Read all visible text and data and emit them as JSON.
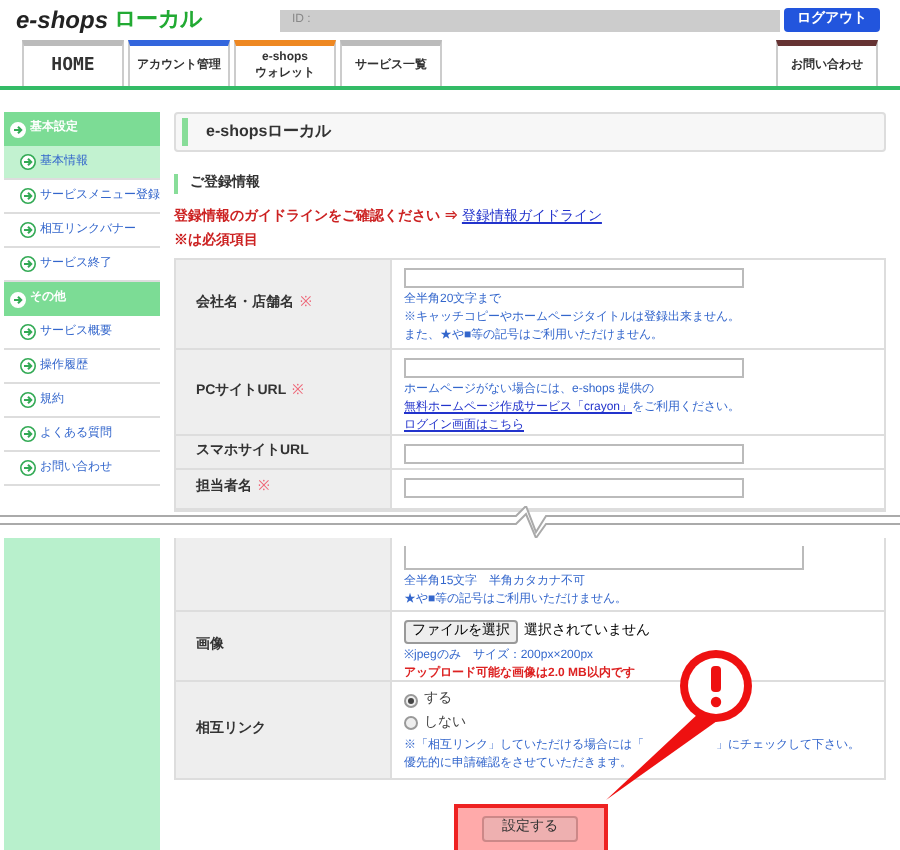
{
  "logo": {
    "part_a": "e-shops",
    "part_b": "ローカル"
  },
  "header": {
    "id_label": "ID :",
    "logout_button": "ログアウト"
  },
  "tabs": [
    {
      "label": "HOME",
      "color": "#bbbbbb"
    },
    {
      "label": "アカウント管理",
      "color": "#3366dd"
    },
    {
      "label": "e-shops\nウォレット",
      "color": "#ee8822"
    },
    {
      "label": "サービス一覧",
      "color": "#bbbbbb"
    }
  ],
  "contact_tab": {
    "label": "お問い合わせ",
    "color": "#663333"
  },
  "sidebar": [
    {
      "title": "基本設定",
      "items": [
        {
          "label": "基本情報",
          "selected": true
        },
        {
          "label": "サービスメニュー登録",
          "selected": false
        },
        {
          "label": "相互リンクバナー",
          "selected": false
        },
        {
          "label": "サービス終了",
          "selected": false
        }
      ]
    },
    {
      "title": "その他",
      "items": [
        {
          "label": "サービス概要",
          "selected": false
        },
        {
          "label": "操作履歴",
          "selected": false
        },
        {
          "label": "規約",
          "selected": false
        },
        {
          "label": "よくある質問",
          "selected": false
        },
        {
          "label": "お問い合わせ",
          "selected": false
        }
      ]
    }
  ],
  "page_title": "e-shopsローカル",
  "section_title": "ご登録情報",
  "guide": {
    "text": "登録情報のガイドラインをご確認ください ⇒",
    "link": "登録情報ガイドライン"
  },
  "required_note": "※は必須項目",
  "required_mark": "※",
  "form_top": [
    {
      "label": "会社名・店舗名",
      "required": true,
      "kind": "input",
      "notes": [
        [
          {
            "kind": "text",
            "text": "全半角20文字まで"
          }
        ],
        [
          {
            "kind": "text",
            "text": "※キャッチコピーやホームページタイトルは登録出来ません。"
          }
        ],
        [
          {
            "kind": "text",
            "text": "また、★や■等の記号はご利用いただけません。"
          }
        ]
      ]
    },
    {
      "label": "PCサイトURL",
      "required": true,
      "kind": "input",
      "notes": [
        [
          {
            "kind": "text",
            "text": "ホームページがない場合には、e-shops 提供の"
          }
        ],
        [
          {
            "kind": "link",
            "text": "無料ホームページ作成サービス「crayon」"
          },
          {
            "kind": "text",
            "text": "をご利用ください。"
          }
        ],
        [
          {
            "kind": "link",
            "text": "ログイン画面はこちら"
          }
        ]
      ]
    },
    {
      "label": "スマホサイトURL",
      "required": false,
      "kind": "input"
    },
    {
      "label": "担当者名",
      "required": true,
      "kind": "input"
    }
  ],
  "form_bottom": [
    {
      "kind": "textarea",
      "notes": [
        [
          {
            "kind": "text",
            "text": "全半角15文字　半角カタカナ不可"
          }
        ],
        [
          {
            "kind": "text",
            "text": "★や■等の記号はご利用いただけません。"
          }
        ]
      ]
    },
    {
      "label": "画像",
      "kind": "file",
      "file_button": "ファイルを選択",
      "file_status": "選択されていません",
      "notes": [
        [
          {
            "kind": "text",
            "text": "※jpegのみ　サイズ：200px×200px"
          }
        ],
        [
          {
            "kind": "alert",
            "text": "アップロード可能な画像は2.0 MB以内です"
          }
        ]
      ]
    },
    {
      "label": "相互リンク",
      "kind": "radio",
      "options": [
        {
          "label": "する",
          "selected": true
        },
        {
          "label": "しない",
          "selected": false
        }
      ],
      "notes": [
        [
          {
            "kind": "text",
            "text": "※「相互リンク」していただける場合には「"
          },
          {
            "kind": "gap",
            "text": "」にチェックして下さい。"
          }
        ],
        [
          {
            "kind": "text",
            "text": "優先的に申請確認をさせていただきます。"
          }
        ]
      ]
    }
  ],
  "submit_button": "設定する"
}
